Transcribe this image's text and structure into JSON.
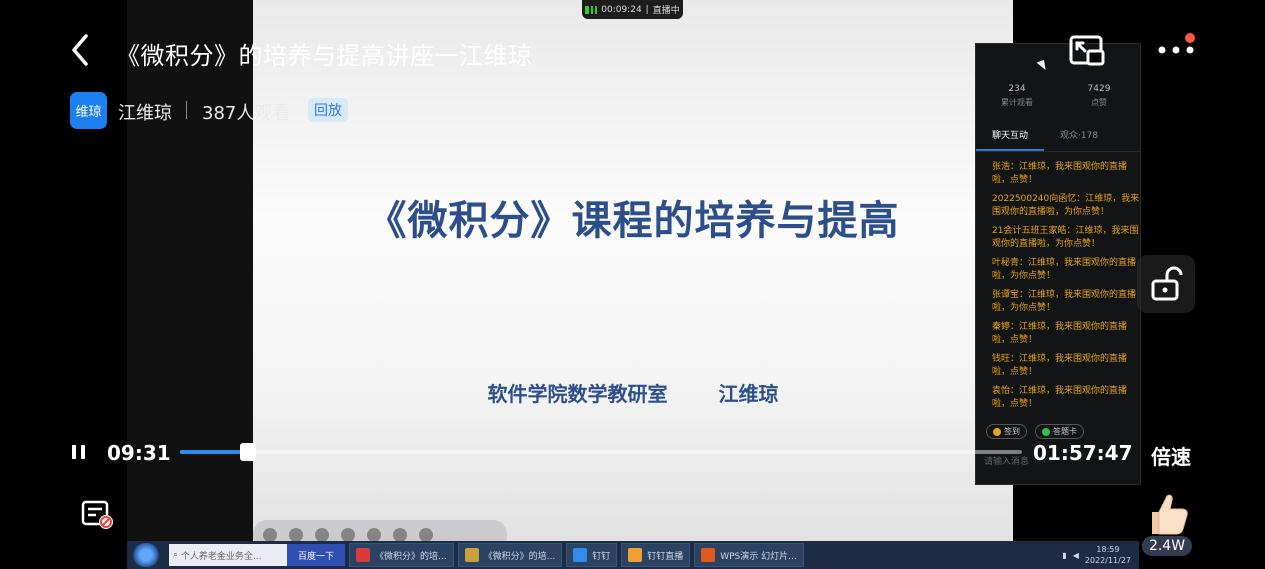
{
  "header": {
    "title": "《微积分》的培养与提高讲座一江维琼",
    "avatar_text": "维琼",
    "host_name": "江维琼",
    "viewers": "387人观看",
    "replay_badge": "回放"
  },
  "recording_badge": {
    "elapsed": "00:09:24",
    "status": "直播中"
  },
  "slide": {
    "title": "《微积分》课程的培养与提高",
    "department": "软件学院数学教研室",
    "presenter": "江维琼"
  },
  "chat_panel": {
    "stats": [
      {
        "value": "234",
        "label": "累计观看"
      },
      {
        "value": "7429",
        "label": "点赞"
      }
    ],
    "tabs": [
      {
        "label": "聊天互动",
        "active": true
      },
      {
        "label": "观众·178",
        "active": false
      }
    ],
    "messages": [
      "张浩：江维琼，我来围观你的直播啦，点赞！",
      "2022500240向函忆：江维琼，我来围观你的直播啦，为你点赞！",
      "21会计五班王家皓：江维琼，我来围观你的直播啦，为你点赞！",
      "叶秘青：江维琼，我来围观你的直播啦，为你点赞！",
      "张谭宝：江维琼，我来围观你的直播啦，为你点赞！",
      "秦婷：江维琼，我来围观你的直播啦，点赞！",
      "钱旺：江维琼，我来围观你的直播啦，点赞！",
      "袁怡：江维琼，我来围观你的直播啦，点赞！"
    ],
    "actions": [
      {
        "label": "签到",
        "color": "#e8a020"
      },
      {
        "label": "答题卡",
        "color": "#2fbf4f"
      }
    ],
    "input_placeholder": "请输入消息"
  },
  "taskbar": {
    "search_placeholder": "个人养老金业务全...",
    "search_button": "百度一下",
    "items": [
      {
        "label": "《微积分》的培...",
        "color": "#d83b3b"
      },
      {
        "label": "《微积分》的培...",
        "color": "#c8a040"
      },
      {
        "label": "钉钉",
        "color": "#2f8df0"
      },
      {
        "label": "钉钉直播",
        "color": "#f0a030"
      },
      {
        "label": "WPS演示 幻灯片...",
        "color": "#e05a20"
      }
    ],
    "time": "18:59",
    "date": "2022/11/27"
  },
  "player": {
    "current_time": "09:31",
    "duration": "01:57:47",
    "progress_fraction": 0.081,
    "speed_label": "倍速",
    "like_count": "2.4W",
    "accent_color": "#2f8df0"
  }
}
